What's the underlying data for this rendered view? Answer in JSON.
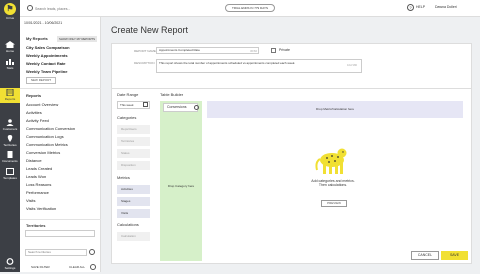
{
  "nav": {
    "items": [
      {
        "label": "Cirrus"
      },
      {
        "label": "Home"
      },
      {
        "label": "Stats"
      },
      {
        "label": "Reports"
      },
      {
        "label": "Customers"
      },
      {
        "label": "Territories"
      },
      {
        "label": "Documents"
      },
      {
        "label": "Templates"
      },
      {
        "label": "Settings"
      }
    ]
  },
  "topbar": {
    "search_placeholder": "Search leads, places...",
    "trial_label": "TRIAL ENDS IN 779 DAYS",
    "help_label": "HELP",
    "user_name": "Dawna Dolleri"
  },
  "sidebar": {
    "date_range": "10/01/2021 - 10/06/2021",
    "my_reports_title": "My Reports",
    "show_button": "SHOW ONLY MY REPORTS",
    "my_reports": [
      "City Sales Comparison",
      "Weekly Appointments",
      "Weekly Contact Rate",
      "Weekly Team Pipeline"
    ],
    "new_report": "NEW REPORT",
    "reports_title": "Reports",
    "reports": [
      "Account Overview",
      "Activities",
      "Activity Feed",
      "Communication Conversion",
      "Communication Logs",
      "Communication Metrics",
      "Conversion Metrics",
      "Distance",
      "Leads Created",
      "Leads Won",
      "Loss Reasons",
      "Performance",
      "Visits",
      "Visits Verification"
    ],
    "territories_title": "Territories",
    "territory_placeholder": "Search territories",
    "save_filter": "SAVE FILTER",
    "clear_all": "CLEAR ALL"
  },
  "main": {
    "title": "Create New Report",
    "report_name_label": "REPORT NAME",
    "report_name": "Appointments Completed Rate",
    "report_count": "30/60",
    "private_label": "Private",
    "description_label": "DESCRIPTION",
    "description": "This report shows the total number of appointments scheduled vs appointments completed each week.",
    "description_count": "102/180",
    "date_range_title": "Date Range",
    "date_range_value": "This week",
    "categories_title": "Categories",
    "categories": [
      "Reps/Users",
      "Territories",
      "Status",
      "Disposition"
    ],
    "metrics_title": "Metrics",
    "metrics": [
      "Activities",
      "Stages",
      "Visits"
    ],
    "calculations_title": "Calculations",
    "calculations": [
      "Calculation"
    ],
    "table_builder_title": "Table Builder",
    "conversion_chip": "Conversions",
    "drop_category": "Drop Category here",
    "drop_metric": "Drop Metric/Calculation here",
    "empty_text": "Add categories and metrics. Then calculations.",
    "preview_button": "PREVIEW",
    "cancel_button": "CANCEL",
    "save_button": "SAVE"
  },
  "colors": {
    "accent": "#f1e033",
    "rail": "#3c3f45",
    "category_zone": "#d6f0c9",
    "metric_zone": "#e6e6f5"
  }
}
